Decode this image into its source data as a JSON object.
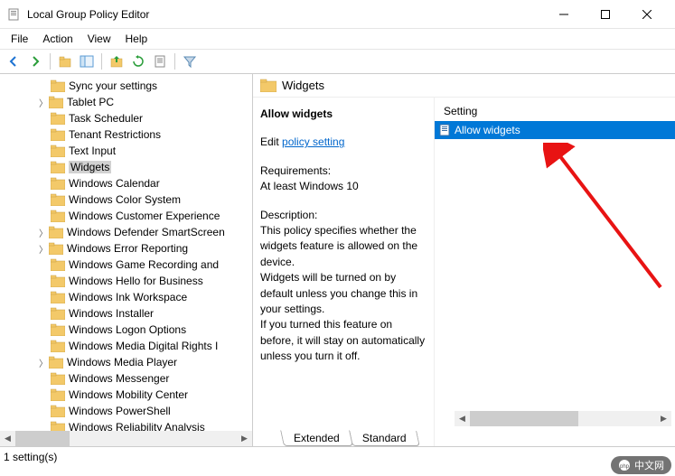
{
  "window": {
    "title": "Local Group Policy Editor"
  },
  "menubar": [
    "File",
    "Action",
    "View",
    "Help"
  ],
  "tree": {
    "items": [
      {
        "label": "Sync your settings",
        "expandable": false
      },
      {
        "label": "Tablet PC",
        "expandable": true
      },
      {
        "label": "Task Scheduler",
        "expandable": false
      },
      {
        "label": "Tenant Restrictions",
        "expandable": false
      },
      {
        "label": "Text Input",
        "expandable": false
      },
      {
        "label": "Widgets",
        "expandable": false,
        "selected": true
      },
      {
        "label": "Windows Calendar",
        "expandable": false
      },
      {
        "label": "Windows Color System",
        "expandable": false
      },
      {
        "label": "Windows Customer Experience",
        "expandable": false
      },
      {
        "label": "Windows Defender SmartScreen",
        "expandable": true
      },
      {
        "label": "Windows Error Reporting",
        "expandable": true
      },
      {
        "label": "Windows Game Recording and",
        "expandable": false
      },
      {
        "label": "Windows Hello for Business",
        "expandable": false
      },
      {
        "label": "Windows Ink Workspace",
        "expandable": false
      },
      {
        "label": "Windows Installer",
        "expandable": false
      },
      {
        "label": "Windows Logon Options",
        "expandable": false
      },
      {
        "label": "Windows Media Digital Rights I",
        "expandable": false
      },
      {
        "label": "Windows Media Player",
        "expandable": true
      },
      {
        "label": "Windows Messenger",
        "expandable": false
      },
      {
        "label": "Windows Mobility Center",
        "expandable": false
      },
      {
        "label": "Windows PowerShell",
        "expandable": false
      },
      {
        "label": "Windows Reliability Analysis",
        "expandable": false
      }
    ]
  },
  "content": {
    "header_title": "Widgets",
    "policy_name": "Allow widgets",
    "edit_prefix": "Edit ",
    "edit_link_text": "policy setting ",
    "requirements_label": "Requirements:",
    "requirements_value": "At least Windows 10",
    "description_label": "Description:",
    "description_text": "This policy specifies whether the widgets feature is allowed on the device.\nWidgets will be turned on by default unless you change this in your settings.\nIf you turned this feature on before, it will stay on automatically unless you turn it off.",
    "settings_header": "Setting",
    "settings_row": "Allow widgets"
  },
  "tabs": [
    "Extended",
    "Standard"
  ],
  "statusbar": "1 setting(s)",
  "watermark": "中文网"
}
